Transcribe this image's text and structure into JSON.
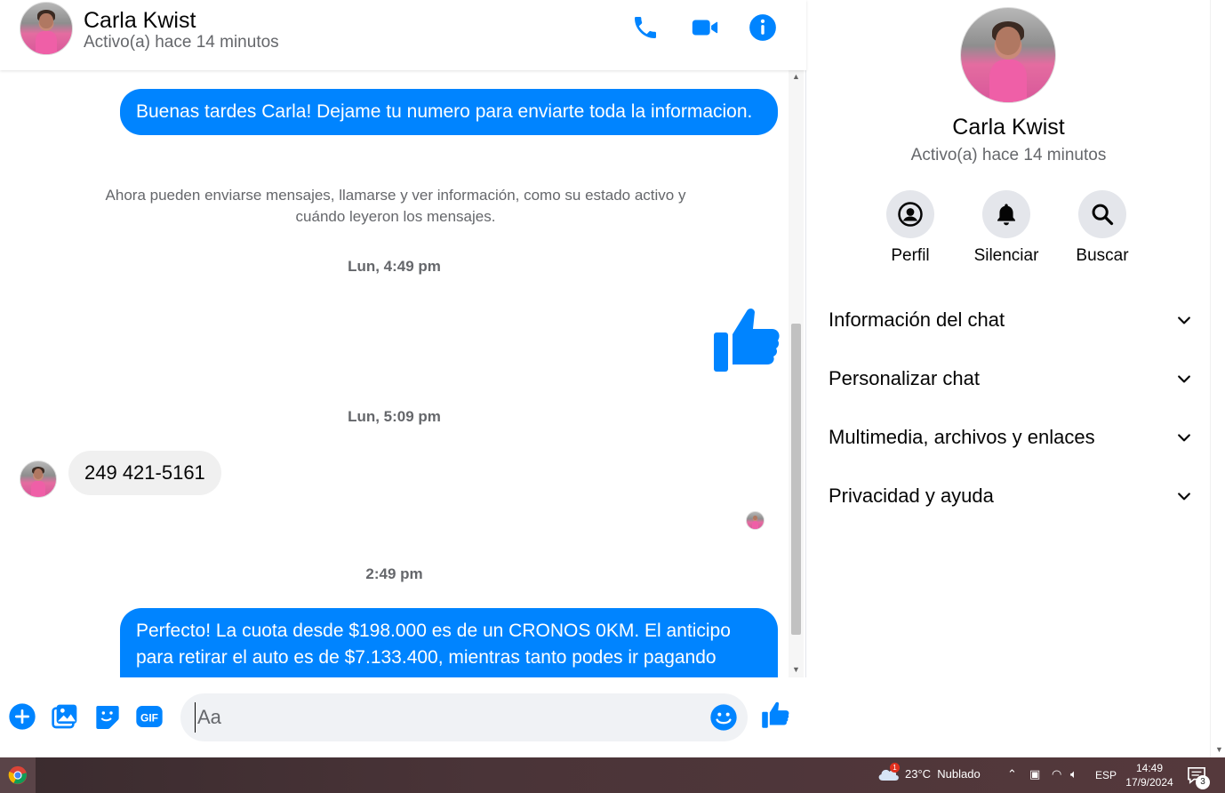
{
  "contact": {
    "name": "Carla Kwist",
    "status": "Activo(a) hace 14 minutos"
  },
  "header_icons": [
    "phone-icon",
    "video-camera-icon",
    "info-icon"
  ],
  "messages": {
    "msg1": "Buenas tardes Carla! Dejame tu numero para enviarte toda la informacion.",
    "system_note": "Ahora pueden enviarse mensajes, llamarse y ver información, como su estado activo y cuándo leyeron los mensajes.",
    "ts1": "Lun, 4:49 pm",
    "ts2": "Lun, 5:09 pm",
    "incoming": "249 421-5161",
    "ts3": "2:49 pm",
    "msg4": "Perfecto! La cuota desde $198.000 es de un CRONOS 0KM. El anticipo para retirar el auto es de $7.133.400, mientras tanto podes ir pagando"
  },
  "composer": {
    "placeholder": "Aa",
    "icons": [
      "plus-icon",
      "photo-icon",
      "sticker-icon",
      "gif-icon",
      "emoji-icon",
      "like-icon"
    ]
  },
  "details": {
    "actions": {
      "profile": "Perfil",
      "mute": "Silenciar",
      "search": "Buscar"
    },
    "sections": {
      "chat_info": "Información del chat",
      "customize": "Personalizar chat",
      "media": "Multimedia, archivos y enlaces",
      "privacy": "Privacidad y ayuda"
    }
  },
  "taskbar": {
    "weather": "23°C  Nublado",
    "weather_badge": "1",
    "language": "ESP",
    "time": "14:49",
    "date": "17/9/2024",
    "notifications": "3"
  },
  "colors": {
    "accent": "#0084ff",
    "incoming_bubble": "#f0f0f0",
    "secondary_text": "#65676b"
  }
}
